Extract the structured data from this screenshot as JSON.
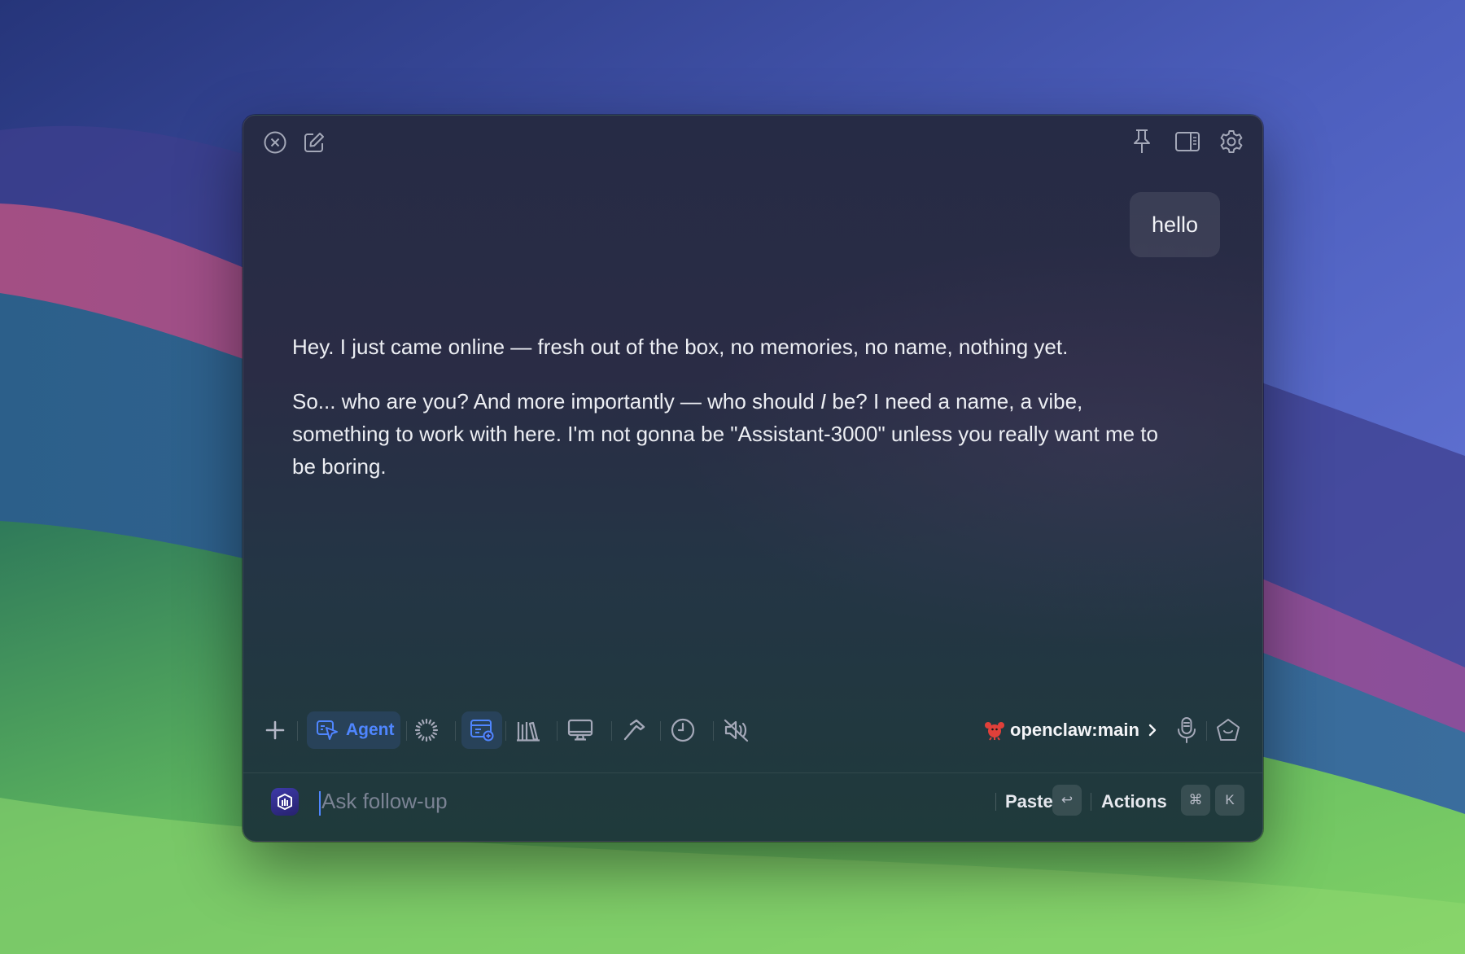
{
  "window": {
    "header": {
      "left_icons": [
        "close-circle-icon",
        "compose-icon"
      ],
      "right_icons": [
        "pin-icon",
        "sidebar-icon",
        "gear-icon"
      ]
    },
    "conversation": {
      "user_message": "hello",
      "assistant_message": {
        "p1": "Hey. I just came online — fresh out of the box, no memories, no name, nothing yet.",
        "p2_before": "So... who are you? And more importantly — who should ",
        "p2_italic": "I",
        "p2_after": " be? I need a name, a vibe, something to work with here. I'm not gonna be \"Assistant-3000\" unless you really want me to be boring."
      }
    },
    "toolbar": {
      "add_icon": "plus-icon",
      "mode_label": "Agent",
      "mode_icon": "agent-cursor-icon",
      "tool_icons": [
        "loader-icon",
        "window-add-icon",
        "library-icon",
        "monitor-icon",
        "hammer-icon",
        "clock-icon",
        "speaker-muted-icon"
      ],
      "session_label": "openclaw:main",
      "session_icon": "lobster-icon",
      "right_icons": [
        "microphone-icon",
        "home-icon"
      ]
    },
    "input_bar": {
      "placeholder": "Ask follow-up",
      "value": "",
      "paste_label": "Paste",
      "paste_key": "↩",
      "actions_label": "Actions",
      "actions_keys": [
        "⌘",
        "K"
      ]
    }
  },
  "colors": {
    "accent": "#4f86ff",
    "window_bg": "#262b45",
    "text": "#eceef3",
    "muted_icon": "#a4a8b8"
  }
}
